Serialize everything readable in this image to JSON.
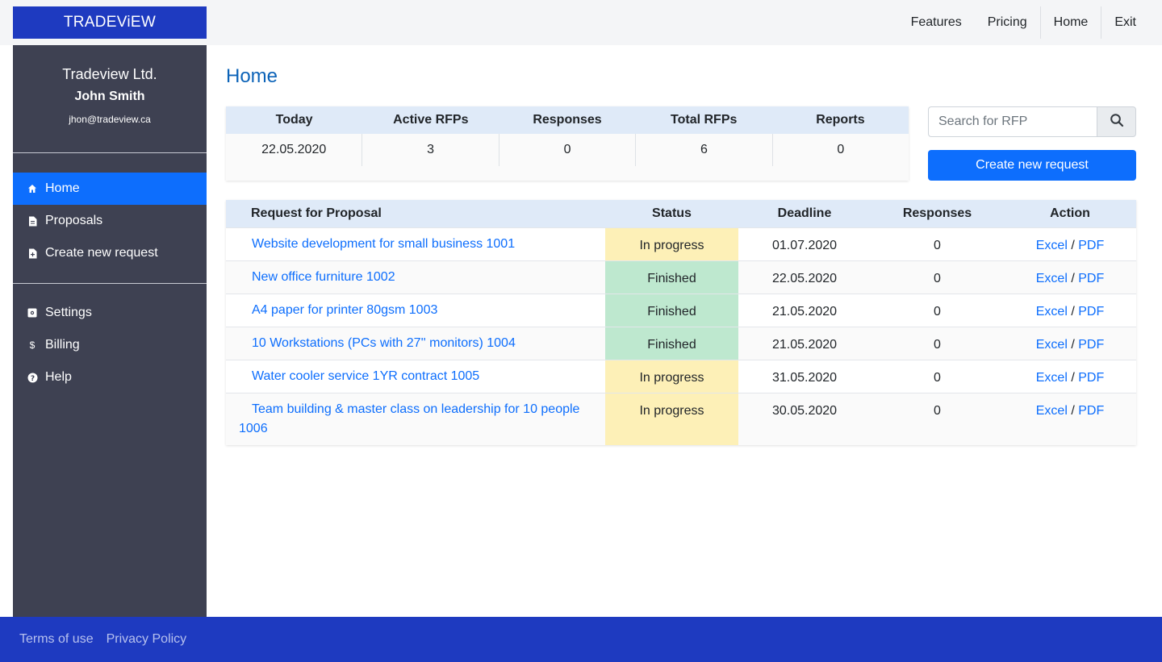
{
  "brand": "TRADEViEW",
  "nav": {
    "features": "Features",
    "pricing": "Pricing",
    "home": "Home",
    "exit": "Exit"
  },
  "profile": {
    "company": "Tradeview Ltd.",
    "user": "John Smith",
    "email": "jhon@tradeview.ca"
  },
  "sidebar": {
    "items": [
      {
        "label": "Home",
        "icon": "home-icon"
      },
      {
        "label": "Proposals",
        "icon": "document-icon"
      },
      {
        "label": "Create new request",
        "icon": "document-add-icon"
      },
      {
        "label": "Settings",
        "icon": "settings-icon"
      },
      {
        "label": "Billing",
        "icon": "dollar-icon"
      },
      {
        "label": "Help",
        "icon": "help-icon"
      }
    ]
  },
  "page_title": "Home",
  "stats": {
    "headers": [
      "Today",
      "Active RFPs",
      "Responses",
      "Total RFPs",
      "Reports"
    ],
    "values": [
      "22.05.2020",
      "3",
      "0",
      "6",
      "0"
    ]
  },
  "search": {
    "placeholder": "Search for RFP"
  },
  "create_button": "Create new request",
  "table": {
    "headers": [
      "Request for Proposal",
      "Status",
      "Deadline",
      "Responses",
      "Action"
    ],
    "rows": [
      {
        "title": "Website development for small business 1001",
        "status": "In progress",
        "deadline": "01.07.2020",
        "responses": "0",
        "excel": "Excel",
        "pdf": "PDF"
      },
      {
        "title": "New office furniture 1002",
        "status": "Finished",
        "deadline": "22.05.2020",
        "responses": "0",
        "excel": "Excel",
        "pdf": "PDF"
      },
      {
        "title": "A4 paper for printer 80gsm 1003",
        "status": "Finished",
        "deadline": "21.05.2020",
        "responses": "0",
        "excel": "Excel",
        "pdf": "PDF"
      },
      {
        "title": "10 Workstations (PCs with 27'' monitors) 1004",
        "status": "Finished",
        "deadline": "21.05.2020",
        "responses": "0",
        "excel": "Excel",
        "pdf": "PDF"
      },
      {
        "title": "Water cooler service 1YR contract 1005",
        "status": "In progress",
        "deadline": "31.05.2020",
        "responses": "0",
        "excel": "Excel",
        "pdf": "PDF"
      },
      {
        "title": "Team building & master class on leadership for 10 people 1006",
        "status": "In progress",
        "deadline": "30.05.2020",
        "responses": "0",
        "excel": "Excel",
        "pdf": "PDF"
      }
    ],
    "action_separator": "/"
  },
  "footer": {
    "terms": "Terms of use",
    "privacy": "Privacy Policy"
  },
  "colors": {
    "brand": "#1e3ac0",
    "primary": "#0d6efd",
    "sidebar": "#3e4152",
    "status_in_progress": "#fdf0b7",
    "status_finished": "#bee8cf"
  }
}
